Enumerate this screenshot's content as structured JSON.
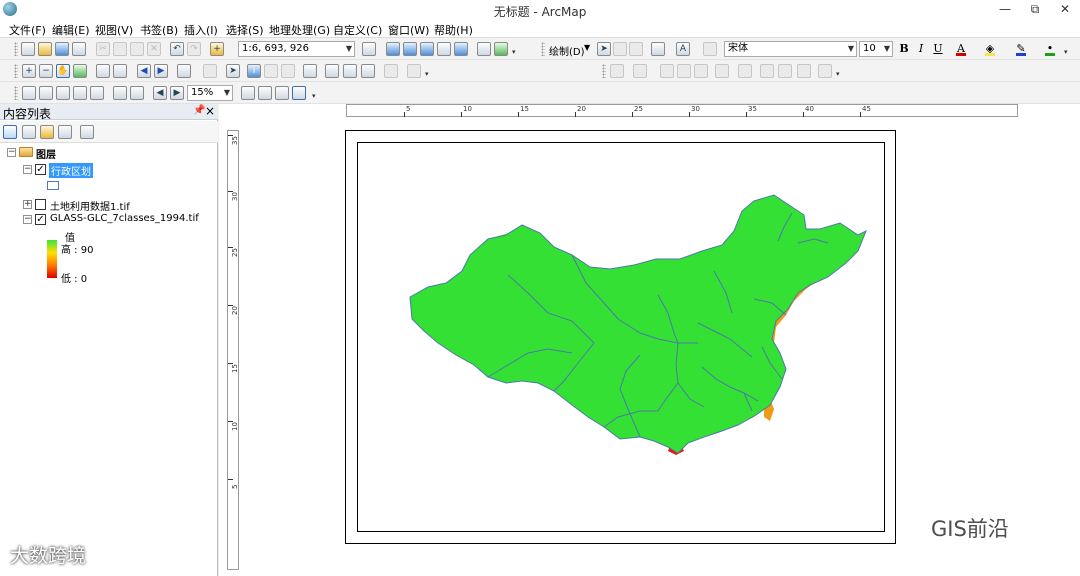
{
  "window": {
    "title": "无标题 - ArcMap",
    "minimize": "—",
    "restore": "⧉",
    "close": "✕"
  },
  "menu": [
    "文件(F)",
    "编辑(E)",
    "视图(V)",
    "书签(B)",
    "插入(I)",
    "选择(S)",
    "地理处理(G)",
    "自定义(C)",
    "窗口(W)",
    "帮助(H)"
  ],
  "toolbar": {
    "scale_value": "1:6, 693, 926",
    "draw_label": "绘制(D)",
    "font_name": "宋体",
    "font_size": "10",
    "bold": "B",
    "italic": "I",
    "underline": "U",
    "font_color_letter": "A",
    "zoom_percent": "15%",
    "colors": {
      "font": "#d40000",
      "fill": "#f4e64b",
      "line": "#1f3fd0",
      "marker": "#1f9d1f"
    }
  },
  "toc": {
    "title": "内容列表",
    "root_label": "图层",
    "layers": [
      {
        "name": "行政区划",
        "checked": "✓",
        "selected": true
      },
      {
        "name": "土地利用数据1.tif",
        "checked": ""
      },
      {
        "name": "GLASS-GLC_7classes_1994.tif",
        "checked": "✓"
      }
    ],
    "legend": {
      "field": "值",
      "high": "高 : 90",
      "low": "低 : 0"
    }
  },
  "rulers": {
    "horizontal": [
      "5",
      "10",
      "15",
      "20",
      "25",
      "30",
      "35",
      "40",
      "45"
    ],
    "vertical": [
      "35",
      "30",
      "25",
      "20",
      "15",
      "10",
      "5"
    ]
  },
  "map_colors": {
    "green": "#33e033",
    "lightgreen": "#7ef03a",
    "orange": "#f09a17",
    "red": "#e81a0e",
    "boundary": "#4d7aa8"
  },
  "watermarks": {
    "left": "大数跨境",
    "right": "GIS前沿"
  }
}
